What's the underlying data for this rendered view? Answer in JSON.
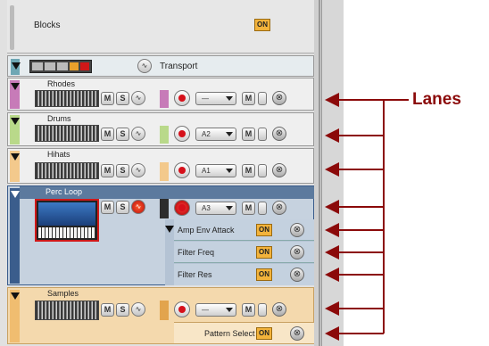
{
  "header": {
    "blocks_label": "Blocks",
    "blocks_on": "ON"
  },
  "transport": {
    "label": "Transport"
  },
  "lanes": [
    {
      "name": "Rhodes",
      "select_value": "—",
      "accent": "#c77bb8"
    },
    {
      "name": "Drums",
      "select_value": "A2",
      "accent": "#b9d98a"
    },
    {
      "name": "Hihats",
      "select_value": "A1",
      "accent": "#f3c98c"
    },
    {
      "name": "Perc Loop",
      "select_value": "A3",
      "accent": "#3b5d8c"
    },
    {
      "name": "Samples",
      "select_value": "—",
      "accent": "#f0bd70"
    }
  ],
  "automation": [
    {
      "label": "Amp Env Attack",
      "on": "ON"
    },
    {
      "label": "Filter Freq",
      "on": "ON"
    },
    {
      "label": "Filter Res",
      "on": "ON"
    },
    {
      "label": "Pattern Select",
      "on": "ON"
    }
  ],
  "buttons": {
    "mute": "M",
    "solo": "S",
    "close": "⊗"
  },
  "callout": {
    "label": "Lanes",
    "color": "#8b0a0a"
  }
}
